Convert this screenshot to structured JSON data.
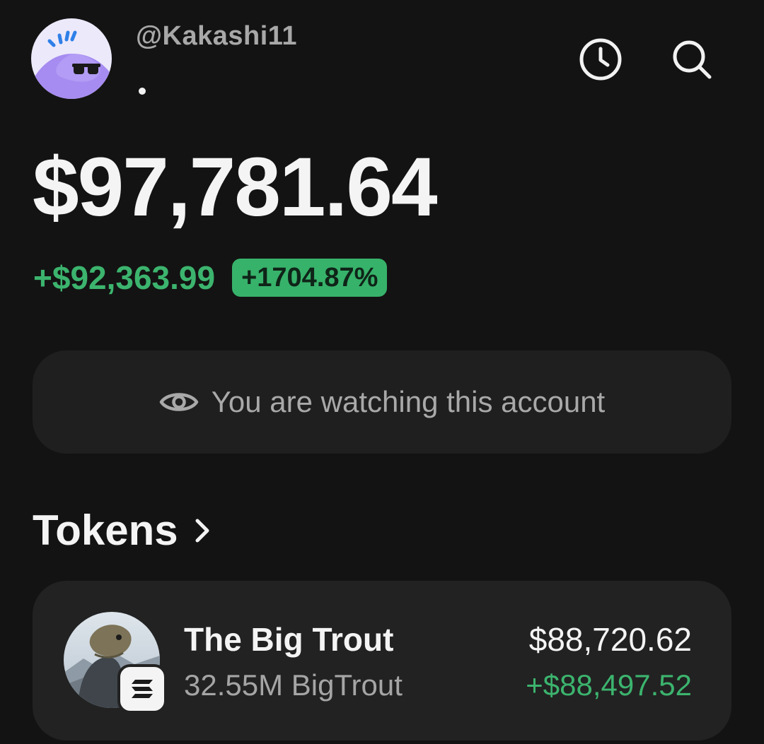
{
  "header": {
    "username": "@Kakashi11",
    "avatar_icon": "sunglasses-character-icon",
    "history_icon": "clock-icon",
    "search_icon": "search-icon"
  },
  "balance": {
    "total": "$97,781.64",
    "change_amount": "+$92,363.99",
    "change_percent": "+1704.87%"
  },
  "watch_banner": {
    "icon": "eye-icon",
    "text": "You are watching this account"
  },
  "tokens": {
    "heading": "Tokens",
    "items": [
      {
        "name": "The Big Trout",
        "amount": "32.55M BigTrout",
        "value": "$88,720.62",
        "change": "+$88,497.52",
        "chain_icon": "solana-icon"
      }
    ]
  },
  "colors": {
    "background": "#131313",
    "card": "#222222",
    "positive": "#3cb46e",
    "muted": "#a9a9a9"
  }
}
